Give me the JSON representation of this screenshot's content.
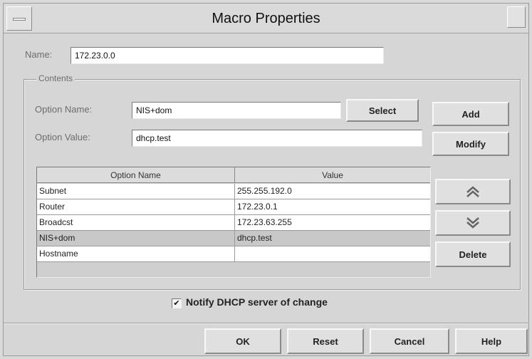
{
  "window": {
    "title": "Macro Properties"
  },
  "name_field": {
    "label": "Name:",
    "value": "172.23.0.0"
  },
  "contents": {
    "title": "Contents",
    "option_name_label": "Option Name:",
    "option_name_value": "NIS+dom",
    "option_value_label": "Option Value:",
    "option_value_value": "dhcp.test",
    "select_label": "Select",
    "add_label": "Add",
    "modify_label": "Modify",
    "move_up_icon": "chevron-up-double",
    "move_down_icon": "chevron-down-double",
    "delete_label": "Delete",
    "table": {
      "columns": [
        "Option Name",
        "Value"
      ],
      "rows": [
        {
          "name": "Subnet",
          "value": "255.255.192.0",
          "selected": false
        },
        {
          "name": "Router",
          "value": "172.23.0.1",
          "selected": false
        },
        {
          "name": "Broadcst",
          "value": "172.23.63.255",
          "selected": false
        },
        {
          "name": "NIS+dom",
          "value": "dhcp.test",
          "selected": true
        },
        {
          "name": "Hostname",
          "value": "",
          "selected": false
        }
      ]
    }
  },
  "notify": {
    "label": "Notify DHCP server of change",
    "checked": true
  },
  "footer": {
    "ok_label": "OK",
    "reset_label": "Reset",
    "cancel_label": "Cancel",
    "help_label": "Help"
  }
}
